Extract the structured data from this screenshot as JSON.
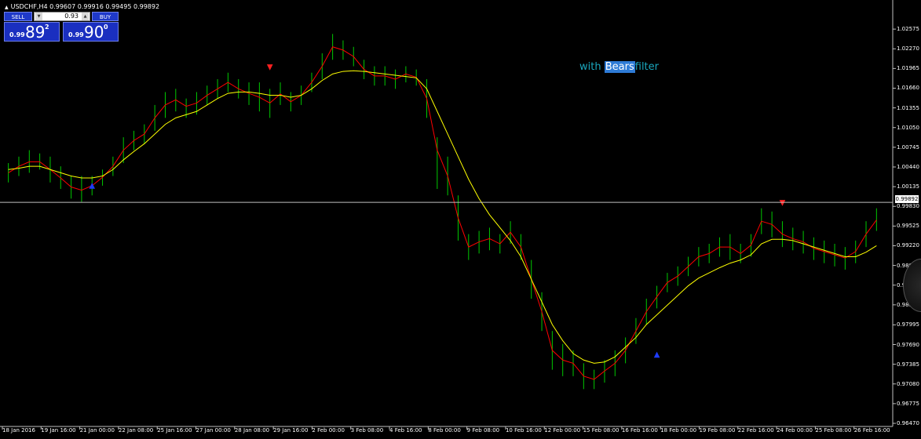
{
  "window": {
    "title": "USDCHF,H4  0.99607 0.99916 0.99495 0.99892"
  },
  "trade_panel": {
    "sell_label": "SELL",
    "buy_label": "BUY",
    "lot_value": "0.93",
    "sell_price": {
      "prefix": "0.99",
      "big": "89",
      "sup": "2"
    },
    "buy_price": {
      "prefix": "0.99",
      "big": "90",
      "sup": "0"
    }
  },
  "filter_label": {
    "pre": "with",
    "highlight": "Bears",
    "post": "filter"
  },
  "current_price": "0.99892",
  "colors": {
    "background": "#000000",
    "bar": "#00c800",
    "fast_ma": "#ff0000",
    "slow_ma": "#ffff00",
    "current_price_line": "#c0c0c0",
    "buy_arrow": "#1e3cff",
    "sell_arrow": "#ff2020",
    "panel_blue": "#1a2fc0"
  },
  "chart_data": {
    "type": "line",
    "symbol": "USDCHF",
    "timeframe": "H4",
    "y_ticks": [
      "1.02575",
      "1.02270",
      "1.01965",
      "1.01660",
      "1.01355",
      "1.01050",
      "1.00745",
      "1.00440",
      "1.00135",
      "0.99830",
      "0.99525",
      "0.99220",
      "0.98915",
      "0.98610",
      "0.98305",
      "0.97995",
      "0.97690",
      "0.97385",
      "0.97080",
      "0.96775",
      "0.96470"
    ],
    "ylim": [
      0.9647,
      1.0288
    ],
    "x_labels": [
      "18 Jan 2016",
      "19 Jan 16:00",
      "21 Jan 00:00",
      "22 Jan 08:00",
      "25 Jan 16:00",
      "27 Jan 00:00",
      "28 Jan 08:00",
      "29 Jan 16:00",
      "2 Feb 00:00",
      "3 Feb 08:00",
      "4 Feb 16:00",
      "8 Feb 00:00",
      "9 Feb 08:00",
      "10 Feb 16:00",
      "12 Feb 00:00",
      "15 Feb 08:00",
      "16 Feb 16:00",
      "18 Feb 00:00",
      "19 Feb 08:00",
      "22 Feb 16:00",
      "24 Feb 00:00",
      "25 Feb 08:00",
      "26 Feb 16:00"
    ],
    "series": [
      {
        "kind": "bars",
        "points": [
          [
            1.005,
            1.002
          ],
          [
            1.006,
            1.003
          ],
          [
            1.007,
            1.0035
          ],
          [
            1.0065,
            1.004
          ],
          [
            1.006,
            1.002
          ],
          [
            1.0045,
            1.001
          ],
          [
            1.003,
            0.9995
          ],
          [
            1.003,
            0.999
          ],
          [
            1.003,
            1.0
          ],
          [
            1.004,
            1.0015
          ],
          [
            1.006,
            1.003
          ],
          [
            1.009,
            1.005
          ],
          [
            1.01,
            1.007
          ],
          [
            1.011,
            1.008
          ],
          [
            1.014,
            1.01
          ],
          [
            1.016,
            1.012
          ],
          [
            1.0165,
            1.013
          ],
          [
            1.015,
            1.012
          ],
          [
            1.016,
            1.0125
          ],
          [
            1.017,
            1.014
          ],
          [
            1.018,
            1.015
          ],
          [
            1.019,
            1.016
          ],
          [
            1.018,
            1.015
          ],
          [
            1.0175,
            1.014
          ],
          [
            1.0175,
            1.013
          ],
          [
            1.0165,
            1.012
          ],
          [
            1.0175,
            1.014
          ],
          [
            1.016,
            1.013
          ],
          [
            1.017,
            1.014
          ],
          [
            1.019,
            1.016
          ],
          [
            1.022,
            1.018
          ],
          [
            1.025,
            1.021
          ],
          [
            1.024,
            1.021
          ],
          [
            1.023,
            1.02
          ],
          [
            1.021,
            1.018
          ],
          [
            1.02,
            1.017
          ],
          [
            1.02,
            1.017
          ],
          [
            1.0195,
            1.0165
          ],
          [
            1.02,
            1.0175
          ],
          [
            1.0195,
            1.017
          ],
          [
            1.018,
            1.012
          ],
          [
            1.009,
            1.001
          ],
          [
            1.006,
            1.0
          ],
          [
            1.0,
            0.993
          ],
          [
            0.994,
            0.99
          ],
          [
            0.9945,
            0.991
          ],
          [
            0.995,
            0.9915
          ],
          [
            0.994,
            0.991
          ],
          [
            0.996,
            0.9925
          ],
          [
            0.994,
            0.99
          ],
          [
            0.99,
            0.984
          ],
          [
            0.985,
            0.979
          ],
          [
            0.979,
            0.973
          ],
          [
            0.977,
            0.972
          ],
          [
            0.976,
            0.972
          ],
          [
            0.974,
            0.97
          ],
          [
            0.973,
            0.97
          ],
          [
            0.9745,
            0.971
          ],
          [
            0.976,
            0.972
          ],
          [
            0.978,
            0.974
          ],
          [
            0.981,
            0.977
          ],
          [
            0.984,
            0.98
          ],
          [
            0.986,
            0.9825
          ],
          [
            0.988,
            0.985
          ],
          [
            0.989,
            0.986
          ],
          [
            0.9905,
            0.9875
          ],
          [
            0.992,
            0.989
          ],
          [
            0.9925,
            0.9895
          ],
          [
            0.9935,
            0.9905
          ],
          [
            0.994,
            0.99
          ],
          [
            0.9925,
            0.9895
          ],
          [
            0.994,
            0.9905
          ],
          [
            0.998,
            0.994
          ],
          [
            0.9975,
            0.9935
          ],
          [
            0.996,
            0.992
          ],
          [
            0.995,
            0.9915
          ],
          [
            0.9945,
            0.991
          ],
          [
            0.9935,
            0.99
          ],
          [
            0.993,
            0.9895
          ],
          [
            0.9925,
            0.989
          ],
          [
            0.992,
            0.9885
          ],
          [
            0.993,
            0.9895
          ],
          [
            0.996,
            0.992
          ],
          [
            0.998,
            0.9945
          ]
        ]
      },
      {
        "name": "",
        "kind": "fast_ma",
        "values": [
          1.0035,
          1.0045,
          1.0052,
          1.0052,
          1.004,
          1.0027,
          1.0013,
          1.0008,
          1.0015,
          1.0028,
          1.0045,
          1.007,
          1.0085,
          1.0095,
          1.012,
          1.014,
          1.0148,
          1.0138,
          1.0143,
          1.0155,
          1.0165,
          1.0175,
          1.0165,
          1.0158,
          1.0152,
          1.0143,
          1.0157,
          1.0145,
          1.0155,
          1.0175,
          1.02,
          1.023,
          1.0225,
          1.0215,
          1.0195,
          1.0185,
          1.0185,
          1.018,
          1.0188,
          1.0183,
          1.015,
          1.007,
          1.003,
          0.9965,
          0.992,
          0.9928,
          0.9933,
          0.9925,
          0.9943,
          0.992,
          0.987,
          0.982,
          0.976,
          0.9745,
          0.974,
          0.972,
          0.9715,
          0.9728,
          0.974,
          0.976,
          0.979,
          0.982,
          0.9843,
          0.9865,
          0.9875,
          0.989,
          0.9905,
          0.991,
          0.992,
          0.992,
          0.991,
          0.9923,
          0.996,
          0.9955,
          0.994,
          0.9933,
          0.9928,
          0.9918,
          0.9913,
          0.9908,
          0.9903,
          0.9913,
          0.994,
          0.9962
        ]
      },
      {
        "name": "",
        "kind": "slow_ma",
        "values": [
          1.004,
          1.0042,
          1.0045,
          1.0045,
          1.004,
          1.0035,
          1.003,
          1.0027,
          1.0027,
          1.003,
          1.004,
          1.0055,
          1.0068,
          1.008,
          1.0095,
          1.011,
          1.012,
          1.0125,
          1.013,
          1.014,
          1.015,
          1.0158,
          1.016,
          1.016,
          1.0158,
          1.0155,
          1.0155,
          1.0152,
          1.0155,
          1.0165,
          1.0178,
          1.0188,
          1.0192,
          1.0193,
          1.0192,
          1.019,
          1.0188,
          1.0186,
          1.0184,
          1.0182,
          1.0165,
          1.013,
          1.0095,
          1.006,
          1.0025,
          0.9995,
          0.997,
          0.995,
          0.993,
          0.9905,
          0.987,
          0.9835,
          0.98,
          0.9775,
          0.9755,
          0.9745,
          0.974,
          0.9742,
          0.975,
          0.9765,
          0.978,
          0.98,
          0.9815,
          0.983,
          0.9845,
          0.986,
          0.9872,
          0.988,
          0.9888,
          0.9895,
          0.99,
          0.9908,
          0.9925,
          0.9932,
          0.9932,
          0.993,
          0.9925,
          0.992,
          0.9915,
          0.991,
          0.9905,
          0.9905,
          0.9912,
          0.9922
        ]
      }
    ],
    "signals": [
      {
        "type": "buy",
        "bar": 8,
        "price": 1.0012
      },
      {
        "type": "sell",
        "bar": 25,
        "price": 1.0195
      },
      {
        "type": "buy",
        "bar": 62,
        "price": 0.975
      },
      {
        "type": "sell",
        "bar": 74,
        "price": 0.9985
      }
    ],
    "grid": false,
    "legend": "none"
  }
}
